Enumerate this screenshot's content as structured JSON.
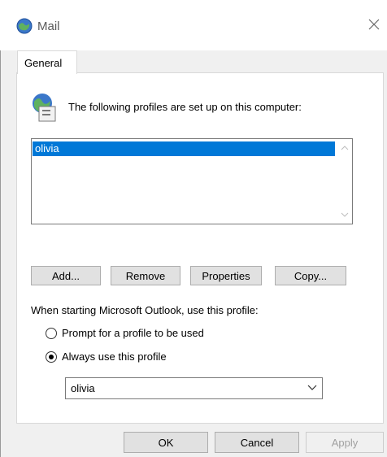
{
  "window": {
    "title": "Mail"
  },
  "tabs": [
    {
      "label": "General"
    }
  ],
  "general": {
    "profiles_label": "The following profiles are set up on this computer:",
    "profiles": [
      "olivia"
    ],
    "selected_profile": "olivia",
    "buttons": {
      "add": "Add...",
      "remove": "Remove",
      "properties": "Properties",
      "copy": "Copy..."
    },
    "startup_label": "When starting Microsoft Outlook, use this profile:",
    "options": {
      "prompt": "Prompt for a profile to be used",
      "always": "Always use this profile"
    },
    "selected_option": "always",
    "always_profile": "olivia"
  },
  "footer": {
    "ok": "OK",
    "cancel": "Cancel",
    "apply": "Apply",
    "apply_enabled": false
  },
  "colors": {
    "selection": "#0078d7",
    "window_bg": "#f0f0f0"
  }
}
